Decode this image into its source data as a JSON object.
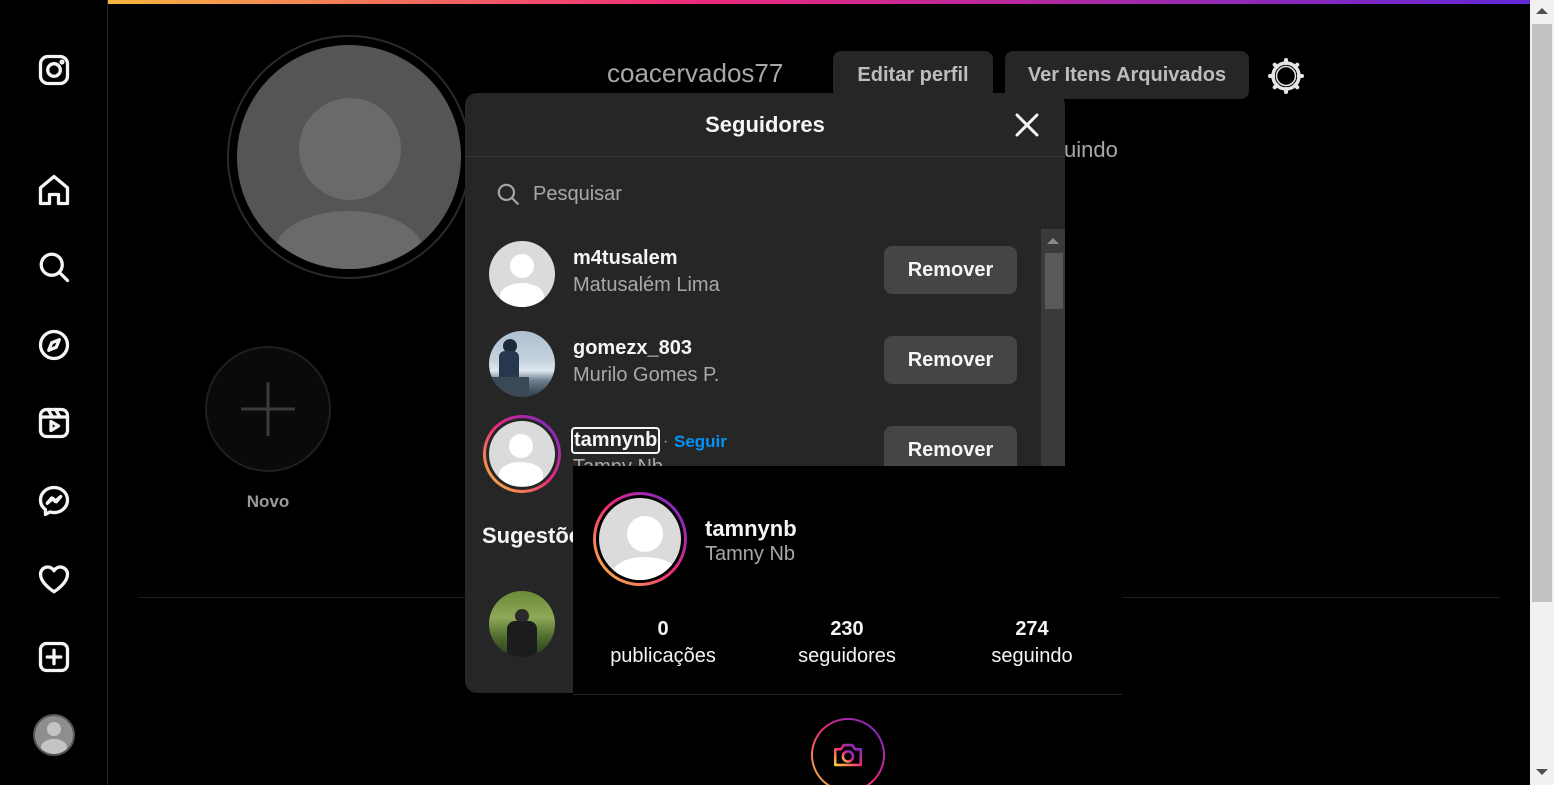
{
  "app": {
    "accent_gradient": [
      "#f9ce34",
      "#ee2a7b",
      "#6228d7"
    ],
    "link_color": "#0095f6"
  },
  "sidebar": {
    "items": [
      {
        "icon": "instagram-logo-icon"
      },
      {
        "icon": "home-icon"
      },
      {
        "icon": "search-icon"
      },
      {
        "icon": "explore-compass-icon"
      },
      {
        "icon": "reels-icon"
      },
      {
        "icon": "messenger-icon"
      },
      {
        "icon": "heart-icon"
      },
      {
        "icon": "create-plus-icon"
      },
      {
        "icon": "profile-avatar"
      }
    ]
  },
  "profile": {
    "username": "coacervados77",
    "edit_profile_label": "Editar perfil",
    "archived_label": "Ver Itens Arquivados",
    "following_partial": "uindo",
    "new_highlight_label": "Novo"
  },
  "modal": {
    "title": "Seguidores",
    "search_placeholder": "Pesquisar",
    "followers": [
      {
        "username": "m4tusalem",
        "full_name": "Matusalém Lima",
        "remove_label": "Remover"
      },
      {
        "username": "gomezx_803",
        "full_name": "Murilo Gomes P.",
        "remove_label": "Remover"
      },
      {
        "username": "tamnynb",
        "full_name": "Tamny Nb",
        "remove_label": "Remover",
        "separator": "·",
        "follow_label": "Seguir"
      }
    ],
    "suggestions_title": "Sugestões"
  },
  "hover_card": {
    "username": "tamnynb",
    "full_name": "Tamny Nb",
    "stats": [
      {
        "value": "0",
        "label": "publicações"
      },
      {
        "value": "230",
        "label": "seguidores"
      },
      {
        "value": "274",
        "label": "seguindo"
      }
    ]
  }
}
